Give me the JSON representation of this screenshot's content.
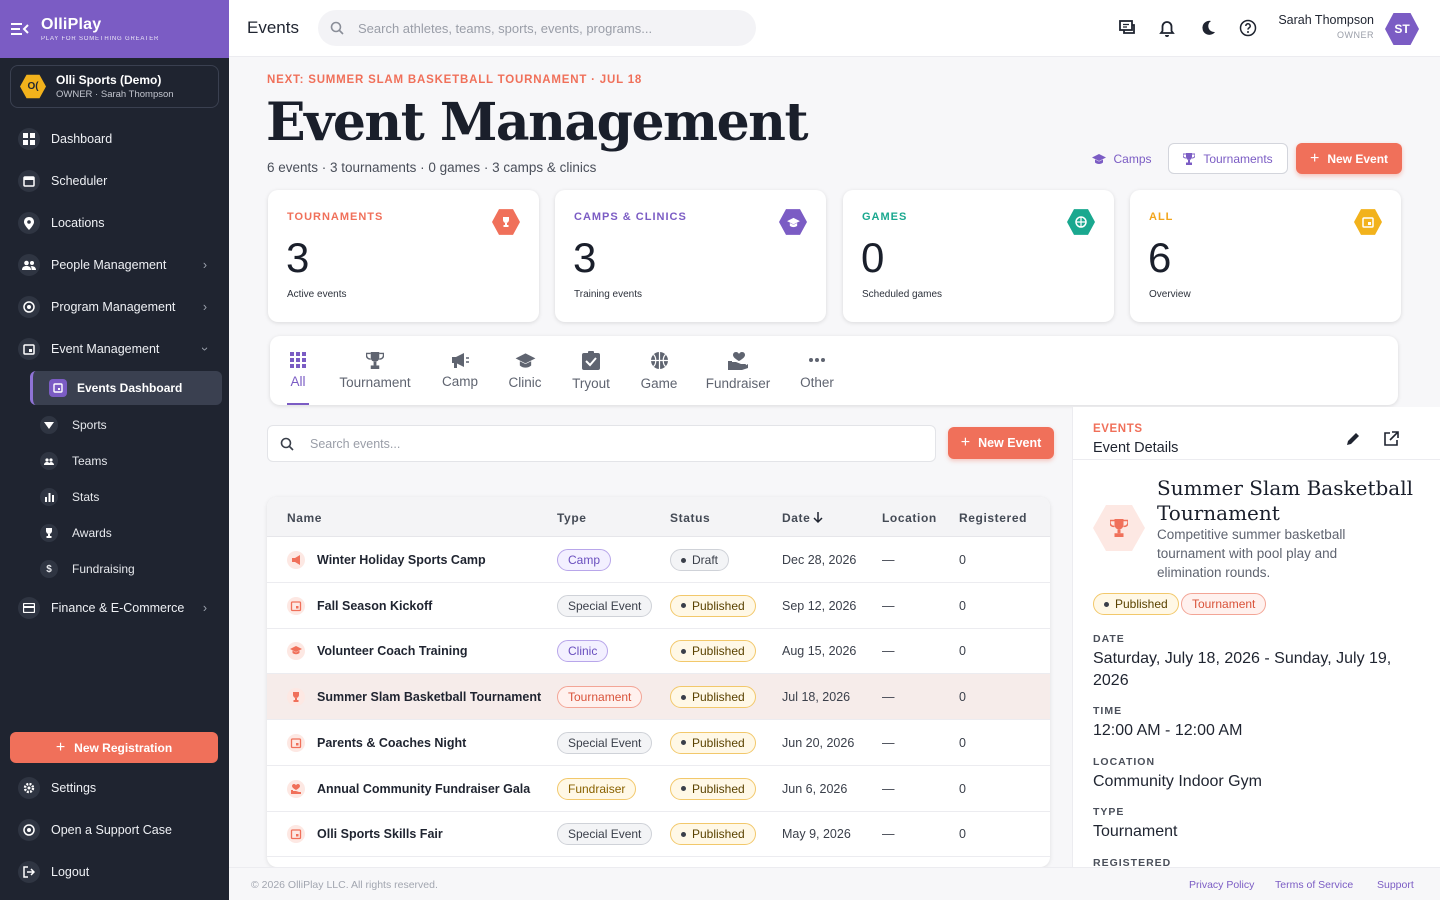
{
  "brand": {
    "name": "OlliPlay",
    "tagline": "PLAY FOR SOMETHING GREATER"
  },
  "org": {
    "initials": "O(",
    "name": "Olli Sports (Demo)",
    "role": "OWNER · Sarah Thompson"
  },
  "sidebar": {
    "items": [
      {
        "label": "Dashboard",
        "icon": "dashboard-icon"
      },
      {
        "label": "Scheduler",
        "icon": "calendar-icon"
      },
      {
        "label": "Locations",
        "icon": "location-pin-icon"
      },
      {
        "label": "People Management",
        "icon": "people-icon"
      },
      {
        "label": "Program Management",
        "icon": "program-icon"
      },
      {
        "label": "Event Management",
        "icon": "event-icon"
      }
    ],
    "event_sub": [
      {
        "label": "Events Dashboard"
      },
      {
        "label": "Sports"
      },
      {
        "label": "Teams"
      },
      {
        "label": "Stats"
      },
      {
        "label": "Awards"
      },
      {
        "label": "Fundraising"
      }
    ],
    "finance": "Finance & E-Commerce",
    "new_registration": "New Registration",
    "bottom": [
      {
        "label": "Settings"
      },
      {
        "label": "Open a Support Case"
      },
      {
        "label": "Logout"
      }
    ]
  },
  "header": {
    "title": "Events",
    "search_placeholder": "Search athletes, teams, sports, events, programs...",
    "user_name": "Sarah Thompson",
    "user_role": "OWNER",
    "user_initials": "ST"
  },
  "page": {
    "next": "NEXT: SUMMER SLAM BASKETBALL TOURNAMENT · JUL 18",
    "title": "Event Management",
    "summary": "6 events · 3 tournaments · 0 games · 3 camps & clinics",
    "camps_btn": "Camps",
    "tournaments_btn": "Tournaments",
    "new_event_btn": "New Event"
  },
  "stats": [
    {
      "label": "TOURNAMENTS",
      "value": "3",
      "sub": "Active events",
      "color": "#f0705a"
    },
    {
      "label": "CAMPS & CLINICS",
      "value": "3",
      "sub": "Training events",
      "color": "#7b5cc4"
    },
    {
      "label": "GAMES",
      "value": "0",
      "sub": "Scheduled games",
      "color": "#1aa88f"
    },
    {
      "label": "ALL",
      "value": "6",
      "sub": "Overview",
      "color": "#f2b21c"
    }
  ],
  "tabs": [
    {
      "label": "All"
    },
    {
      "label": "Tournament"
    },
    {
      "label": "Camp"
    },
    {
      "label": "Clinic"
    },
    {
      "label": "Tryout"
    },
    {
      "label": "Game"
    },
    {
      "label": "Fundraiser"
    },
    {
      "label": "Other"
    }
  ],
  "events_search_placeholder": "Search events...",
  "events_new_btn": "New Event",
  "table": {
    "columns": [
      "Name",
      "Type",
      "Status",
      "Date",
      "Location",
      "Registered"
    ],
    "rows": [
      {
        "name": "Winter Holiday Sports Camp",
        "type": "Camp",
        "status": "Draft",
        "date": "Dec 28, 2026",
        "location": "—",
        "registered": "0"
      },
      {
        "name": "Fall Season Kickoff",
        "type": "Special Event",
        "status": "Published",
        "date": "Sep 12, 2026",
        "location": "—",
        "registered": "0"
      },
      {
        "name": "Volunteer Coach Training",
        "type": "Clinic",
        "status": "Published",
        "date": "Aug 15, 2026",
        "location": "—",
        "registered": "0"
      },
      {
        "name": "Summer Slam Basketball Tournament",
        "type": "Tournament",
        "status": "Published",
        "date": "Jul 18, 2026",
        "location": "—",
        "registered": "0"
      },
      {
        "name": "Parents & Coaches Night",
        "type": "Special Event",
        "status": "Published",
        "date": "Jun 20, 2026",
        "location": "—",
        "registered": "0"
      },
      {
        "name": "Annual Community Fundraiser Gala",
        "type": "Fundraiser",
        "status": "Published",
        "date": "Jun 6, 2026",
        "location": "—",
        "registered": "0"
      },
      {
        "name": "Olli Sports Skills Fair",
        "type": "Special Event",
        "status": "Published",
        "date": "May 9, 2026",
        "location": "—",
        "registered": "0"
      }
    ]
  },
  "details": {
    "kicker": "EVENTS",
    "heading": "Event Details",
    "title": "Summer Slam Basketball Tournament",
    "description": "Competitive summer basketball tournament with pool play and elimination rounds.",
    "status": "Published",
    "type_badge": "Tournament",
    "date_label": "DATE",
    "date": "Saturday, July 18, 2026 - Sunday, July 19, 2026",
    "time_label": "TIME",
    "time": "12:00 AM - 12:00 AM",
    "location_label": "LOCATION",
    "location": "Community Indoor Gym",
    "type_label": "TYPE",
    "type": "Tournament",
    "registered_label": "REGISTERED"
  },
  "footer": {
    "copyright": "© 2026 OlliPlay LLC. All rights reserved.",
    "links": [
      "Privacy Policy",
      "Terms of Service",
      "Support"
    ]
  }
}
